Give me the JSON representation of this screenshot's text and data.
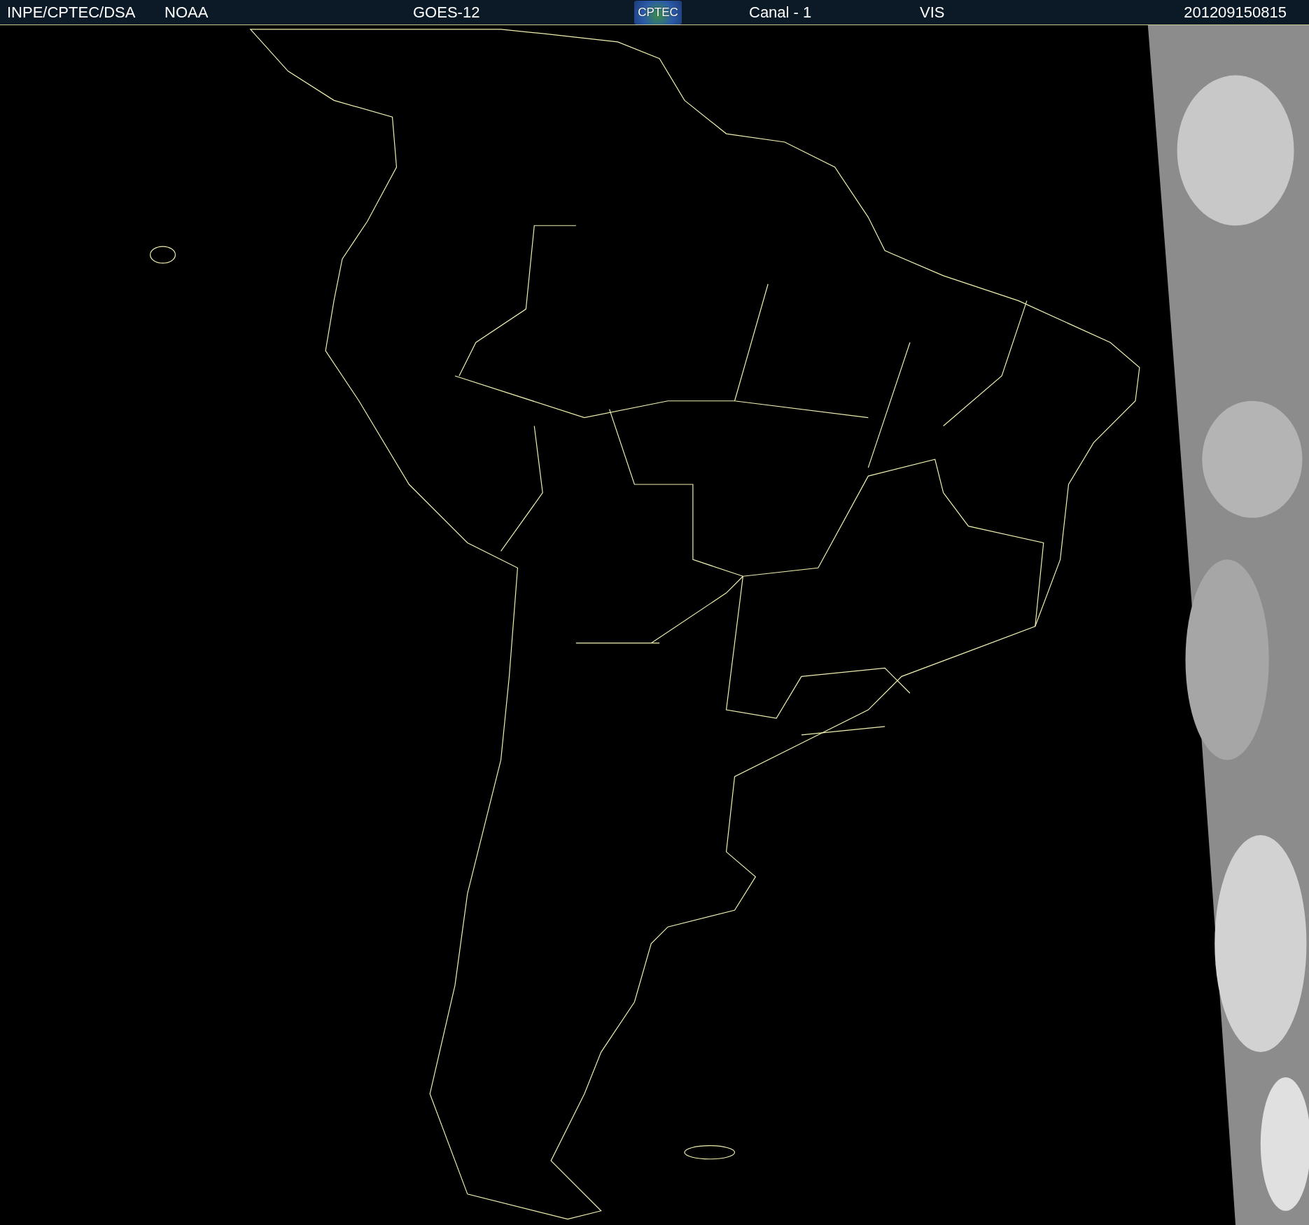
{
  "header": {
    "items": [
      {
        "kind": "text",
        "text": "INPE/CPTEC/DSA"
      },
      {
        "kind": "text",
        "text": "NOAA"
      },
      {
        "kind": "text",
        "text": "GOES-12"
      },
      {
        "kind": "logo",
        "text": "CPTEC"
      },
      {
        "kind": "text",
        "text": "Canal - 1"
      },
      {
        "kind": "text",
        "text": "VIS"
      },
      {
        "kind": "text",
        "text": "201209150815"
      }
    ]
  }
}
